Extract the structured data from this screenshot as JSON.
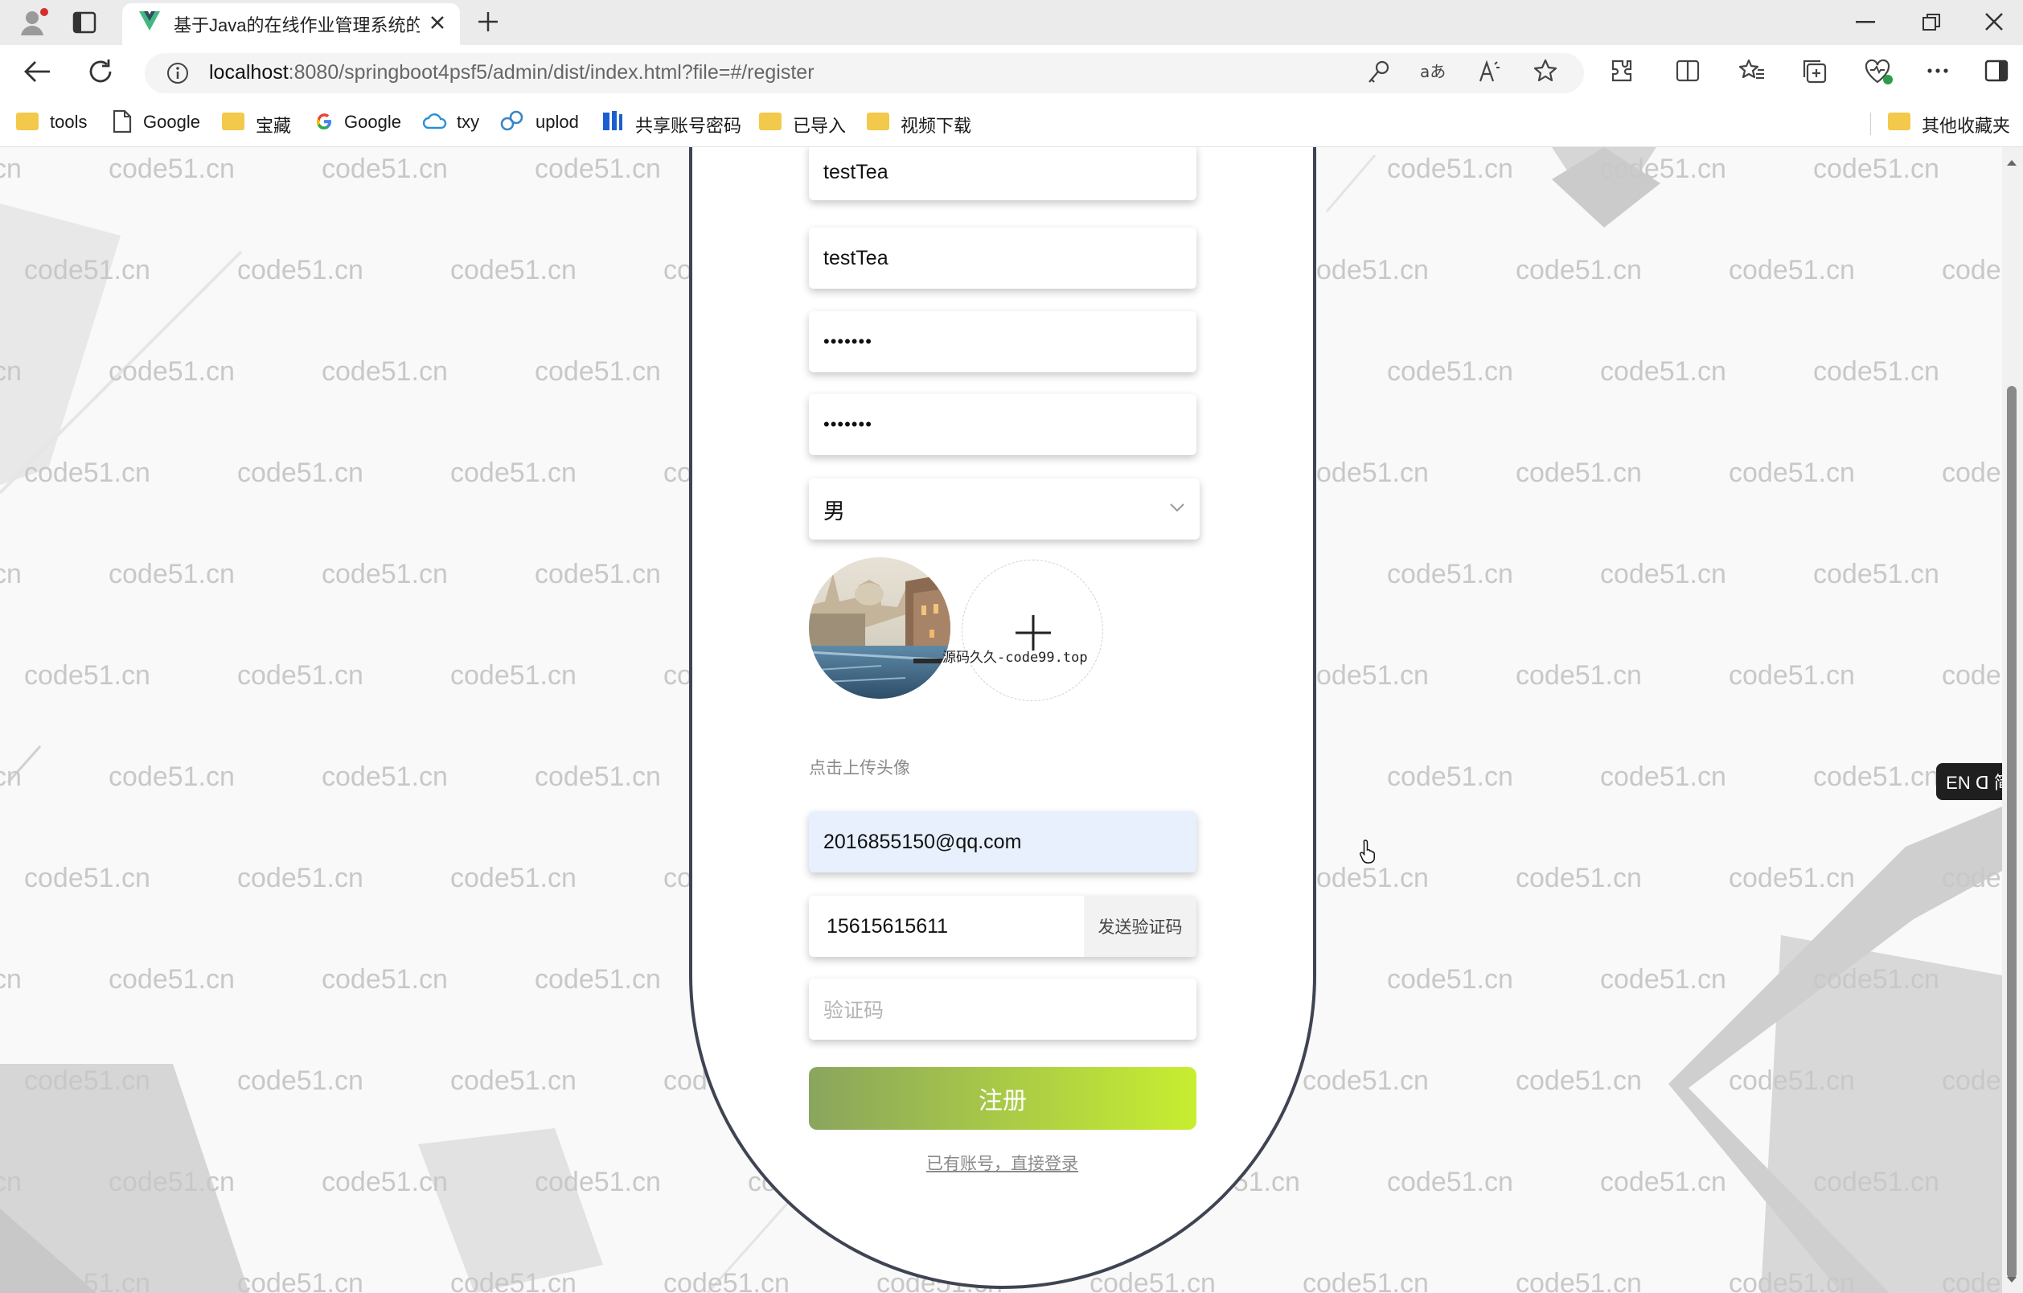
{
  "browser": {
    "tab_title": "基于Java的在线作业管理系统的讠",
    "url_host": "localhost",
    "url_rest": ":8080/springboot4psf5/admin/dist/index.html?file=#/register",
    "bookmarks": [
      "tools",
      "Google",
      "宝藏",
      "Google",
      "txy",
      "uplod",
      "共享账号密码",
      "已导入",
      "视频下载"
    ],
    "other_bookmarks": "其他收藏夹"
  },
  "form": {
    "account": "testTea",
    "name": "testTea",
    "password": "•••••••",
    "confirm_password": "•••••••",
    "gender": "男",
    "upload_hint": "点击上传头像",
    "email": "2016855150@qq.com",
    "phone": "15615615611",
    "send_code": "发送验证码",
    "code_placeholder": "验证码",
    "register": "注册",
    "login_link": "已有账号，直接登录"
  },
  "overlay": {
    "watermark": "code51.cn",
    "upload_watermark": "源码久久-code99.top",
    "ime": "EN ᗡ 简"
  },
  "colors": {
    "card_border": "#3f4452",
    "button_start": "#8aa55e",
    "button_end": "#c8ee30",
    "email_bg": "#e8f0fe"
  }
}
